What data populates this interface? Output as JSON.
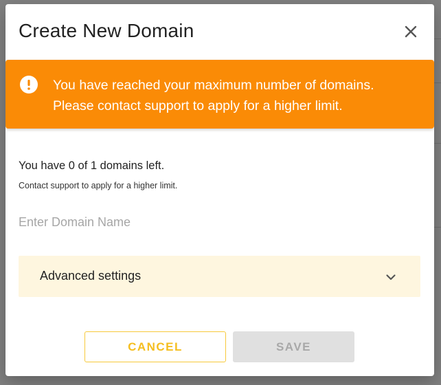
{
  "modal": {
    "title": "Create New Domain",
    "close_icon": "close-icon"
  },
  "alert": {
    "icon": "exclamation-circle-icon",
    "line1": "You have reached your maximum number of domains.",
    "line2": "Please contact support to apply for a higher limit.",
    "color": "#fa8b06"
  },
  "quota": {
    "text": "You have 0 of 1 domains left.",
    "subtext": "Contact support to apply for a higher limit."
  },
  "domain_input": {
    "value": "",
    "placeholder": "Enter Domain Name"
  },
  "advanced": {
    "label": "Advanced settings",
    "icon": "chevron-down-icon",
    "background": "#fef6df"
  },
  "buttons": {
    "cancel_label": "CANCEL",
    "save_label": "SAVE",
    "accent": "#f5be1f"
  }
}
